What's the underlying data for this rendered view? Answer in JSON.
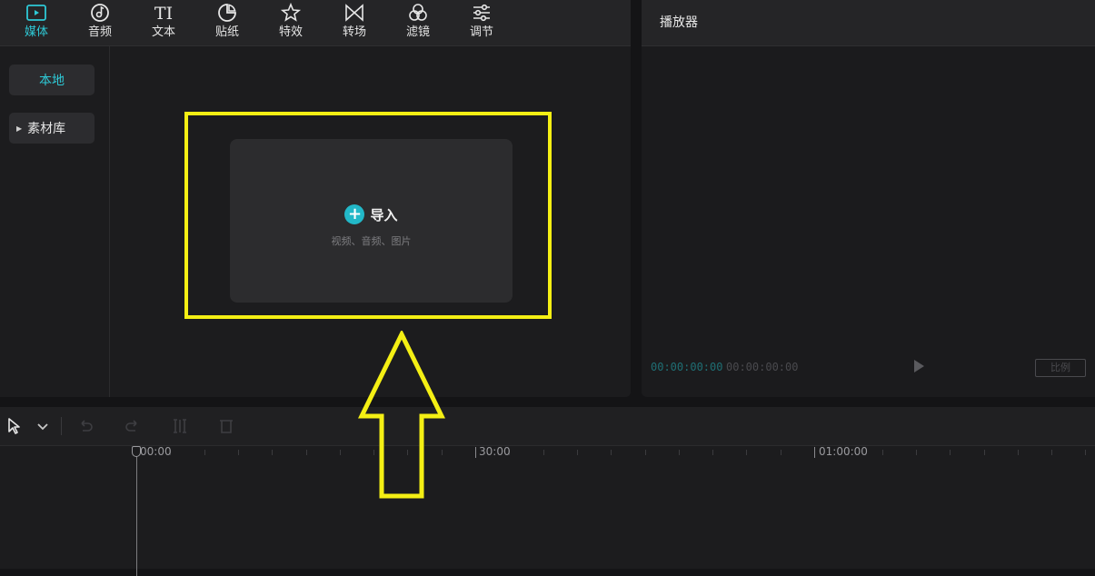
{
  "toolbar": {
    "tools": [
      {
        "name": "media",
        "label": "媒体",
        "icon": "media-icon",
        "active": true
      },
      {
        "name": "audio",
        "label": "音频",
        "icon": "audio-icon"
      },
      {
        "name": "text",
        "label": "文本",
        "icon": "text-icon",
        "glyph": "TI"
      },
      {
        "name": "sticker",
        "label": "贴纸",
        "icon": "sticker-icon"
      },
      {
        "name": "effects",
        "label": "特效",
        "icon": "effects-icon"
      },
      {
        "name": "transition",
        "label": "转场",
        "icon": "transition-icon"
      },
      {
        "name": "filter",
        "label": "滤镜",
        "icon": "filter-icon"
      },
      {
        "name": "adjust",
        "label": "调节",
        "icon": "adjust-icon"
      }
    ]
  },
  "sidebar": {
    "items": [
      {
        "label": "本地",
        "active": true
      },
      {
        "label": "素材库",
        "expandable": true
      }
    ]
  },
  "import": {
    "plus": "+",
    "label": "导入",
    "hint": "视频、音频、图片"
  },
  "player": {
    "title": "播放器",
    "time_current": "00:00:00:00",
    "time_total": "00:00:00:00",
    "ratio_label": "比例"
  },
  "timeline": {
    "ruler_labels": [
      "00:00",
      "30:00",
      "01:00:00"
    ],
    "tools": [
      "select-icon",
      "dropdown-icon",
      "undo-icon",
      "redo-icon",
      "split-icon",
      "delete-icon"
    ]
  },
  "colors": {
    "accent": "#2ec9d6",
    "highlight": "#f4ef14",
    "panel": "#1c1c1e",
    "header": "#252527"
  }
}
